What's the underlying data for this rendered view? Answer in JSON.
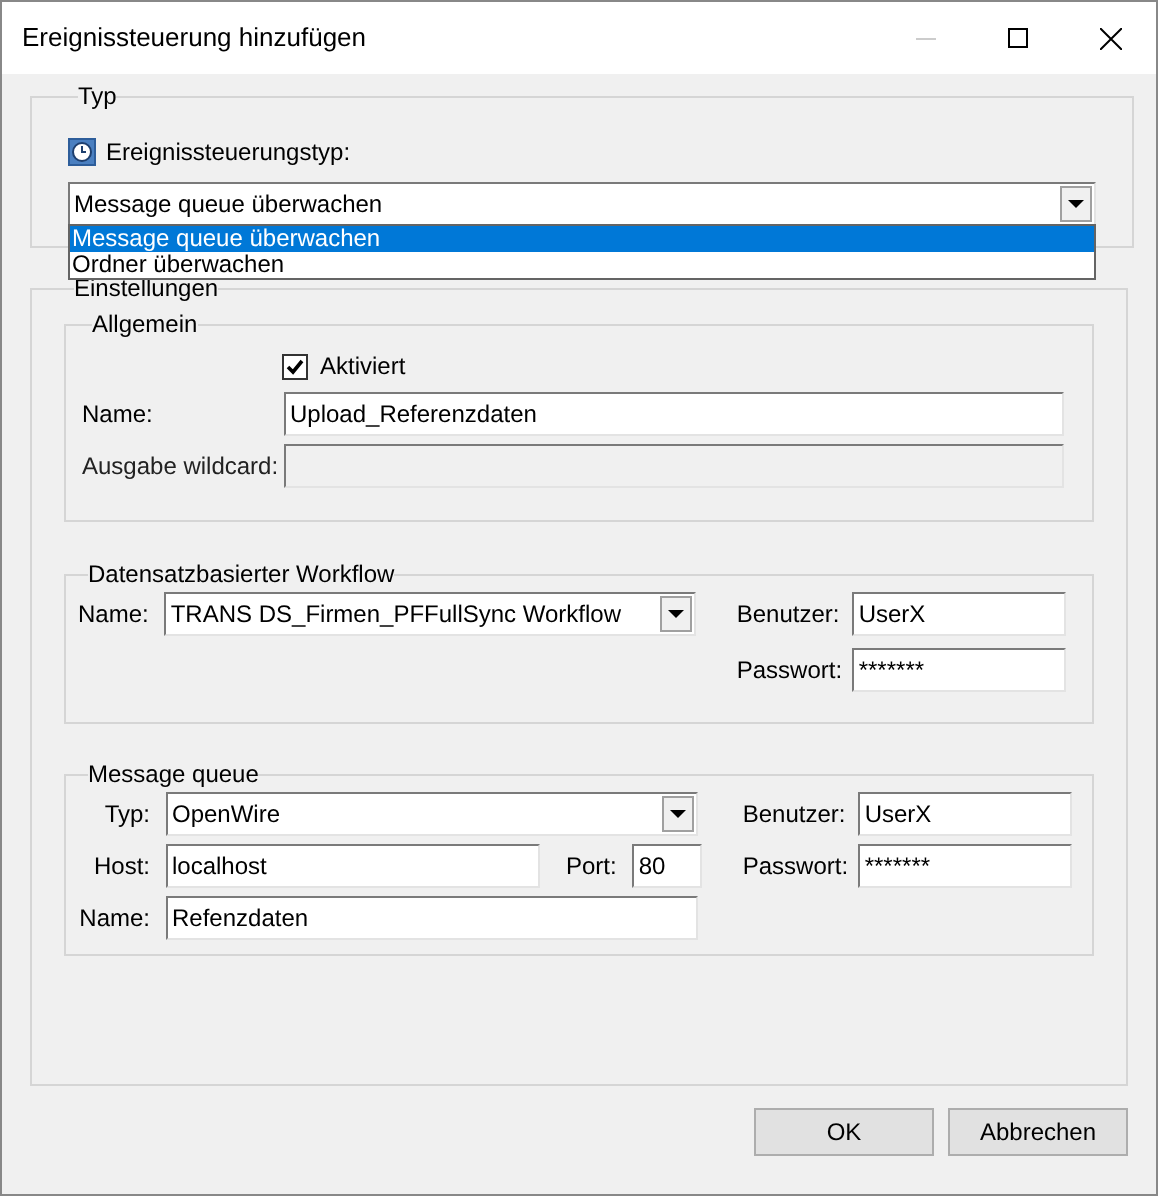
{
  "window": {
    "title": "Ereignissteuerung hinzufügen"
  },
  "typ": {
    "legend": "Typ",
    "label": "Ereignissteuerungstyp:",
    "value": "Message queue überwachen",
    "options": [
      {
        "label": "Message queue überwachen",
        "selected": true
      },
      {
        "label": "Ordner überwachen",
        "selected": false
      }
    ]
  },
  "settings": {
    "legend": "Einstellungen",
    "general": {
      "legend": "Allgemein",
      "active": {
        "label": "Aktiviert",
        "checked": true
      },
      "name": {
        "label": "Name:",
        "value": "Upload_Referenzdaten"
      },
      "wildcard": {
        "label": "Ausgabe wildcard:",
        "disabled": true
      }
    },
    "workflow": {
      "legend": "Datensatzbasierter Workflow",
      "name": {
        "label": "Name:",
        "value": "TRANS DS_Firmen_PFFullSync Workflow"
      },
      "user": {
        "label": "Benutzer:",
        "value": "UserX"
      },
      "password": {
        "label": "Passwort:",
        "value": "*******"
      }
    },
    "queue": {
      "legend": "Message queue",
      "type": {
        "label": "Typ:",
        "value": "OpenWire"
      },
      "host": {
        "label": "Host:",
        "value": "localhost"
      },
      "port": {
        "label": "Port:",
        "value": "80"
      },
      "user": {
        "label": "Benutzer:",
        "value": "UserX"
      },
      "password": {
        "label": "Passwort:",
        "value": "*******"
      },
      "name": {
        "label": "Name:",
        "value": "Refenzdaten"
      }
    }
  },
  "buttons": [
    "OK",
    "Abbrechen"
  ]
}
